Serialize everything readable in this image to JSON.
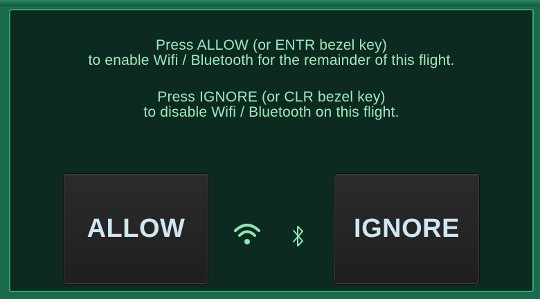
{
  "dialog": {
    "message_allow_line1": "Press ALLOW (or ENTR bezel key)",
    "message_allow_line2": "to enable Wifi / Bluetooth for the remainder of this flight.",
    "message_ignore_line1": "Press IGNORE (or CLR bezel key)",
    "message_ignore_line2": "to disable Wifi / Bluetooth on this flight."
  },
  "buttons": {
    "allow_label": "ALLOW",
    "ignore_label": "IGNORE"
  },
  "icons": {
    "wifi": "wifi-icon",
    "bluetooth": "bluetooth-icon"
  },
  "colors": {
    "text": "#9fe9bf",
    "icon": "#8fe6b3",
    "panel": "#0d2a20",
    "border": "#2ea776",
    "button": "#262626",
    "button_text": "#cfe7f0"
  }
}
